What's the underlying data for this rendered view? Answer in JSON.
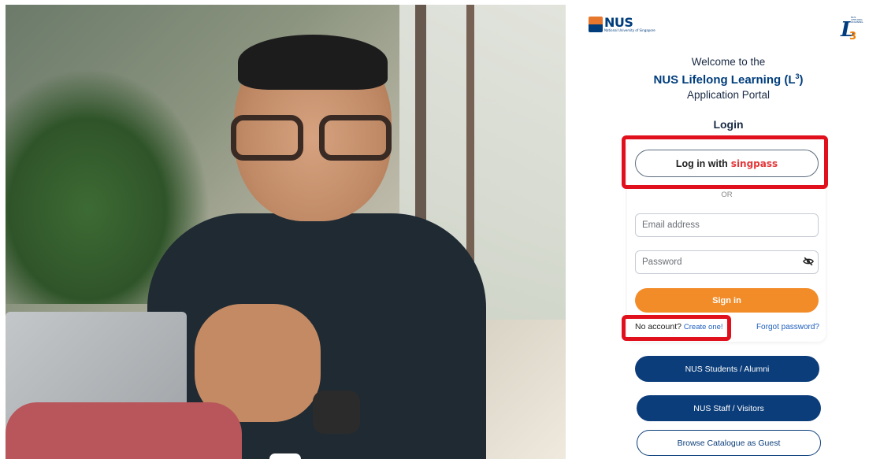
{
  "logos": {
    "nus_name": "NUS",
    "nus_sub": "National University of Singapore",
    "l3_letter": "L",
    "l3_sup": "3",
    "l3_small": "NUS LIFELONG LEARNING"
  },
  "welcome": {
    "line1": "Welcome to the",
    "line2": "NUS Lifelong Learning (L",
    "line2_sup": "3",
    "line2_end": ")",
    "line3": "Application Portal"
  },
  "login": {
    "title": "Login",
    "singpass_prefix": "Log in with",
    "singpass_brand": "singpass",
    "or": "OR",
    "email_placeholder": "Email address",
    "password_placeholder": "Password",
    "signin": "Sign in",
    "no_account": "No account?",
    "create": "Create one!",
    "forgot": "Forgot password?"
  },
  "actions": {
    "students": "NUS Students / Alumni",
    "staff": "NUS Staff / Visitors",
    "guest": "Browse Catalogue as Guest"
  },
  "colors": {
    "nus_blue": "#003d7c",
    "orange": "#f28c28",
    "highlight": "#e0101c",
    "singpass_red": "#e4363a"
  },
  "icons": {
    "password_toggle": "eye-slash-icon"
  }
}
